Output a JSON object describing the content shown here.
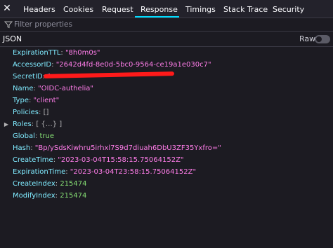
{
  "tabs": {
    "close_glyph": "✕",
    "items": [
      {
        "label": "Headers"
      },
      {
        "label": "Cookies"
      },
      {
        "label": "Request"
      },
      {
        "label": "Response"
      },
      {
        "label": "Timings"
      },
      {
        "label": "Stack Trace"
      },
      {
        "label": "Security"
      }
    ],
    "active": "Response",
    "accent_color": "#00ddff"
  },
  "filter": {
    "placeholder": "Filter properties",
    "value": ""
  },
  "toolbar": {
    "mode_label": "JSON",
    "raw_label": "Raw",
    "raw_enabled": false
  },
  "json": {
    "expiration_ttl": {
      "key": "ExpirationTTL",
      "value": "\"8h0m0s\""
    },
    "accessor_id": {
      "key": "AccessorID",
      "value": "\"2642d4fd-8e0d-5bc0-9564-ce19a1e030c7\""
    },
    "secret_id": {
      "key": "SecretID",
      "value": "\"",
      "redacted": true
    },
    "name": {
      "key": "Name",
      "value": "\"OIDC-authelia\""
    },
    "type": {
      "key": "Type",
      "value": "\"client\""
    },
    "policies": {
      "key": "Policies",
      "value": "[]"
    },
    "roles": {
      "key": "Roles",
      "value": "[ {…} ]"
    },
    "global": {
      "key": "Global",
      "value": "true"
    },
    "hash": {
      "key": "Hash",
      "value": "\"Bp/ySdsKiwhru5irhxl7S9d7diuah6DbU3ZF35Yxfro=\""
    },
    "create_time": {
      "key": "CreateTime",
      "value": "\"2023-03-04T15:58:15.75064152Z\""
    },
    "expiration_time": {
      "key": "ExpirationTime",
      "value": "\"2023-03-04T23:58:15.75064152Z\""
    },
    "create_index": {
      "key": "CreateIndex",
      "value": "215474"
    },
    "modify_index": {
      "key": "ModifyIndex",
      "value": "215474"
    }
  },
  "colors": {
    "string": "#ff7de9",
    "number": "#86de74",
    "key": "#80ebff",
    "redaction": "#ff1a1a"
  }
}
